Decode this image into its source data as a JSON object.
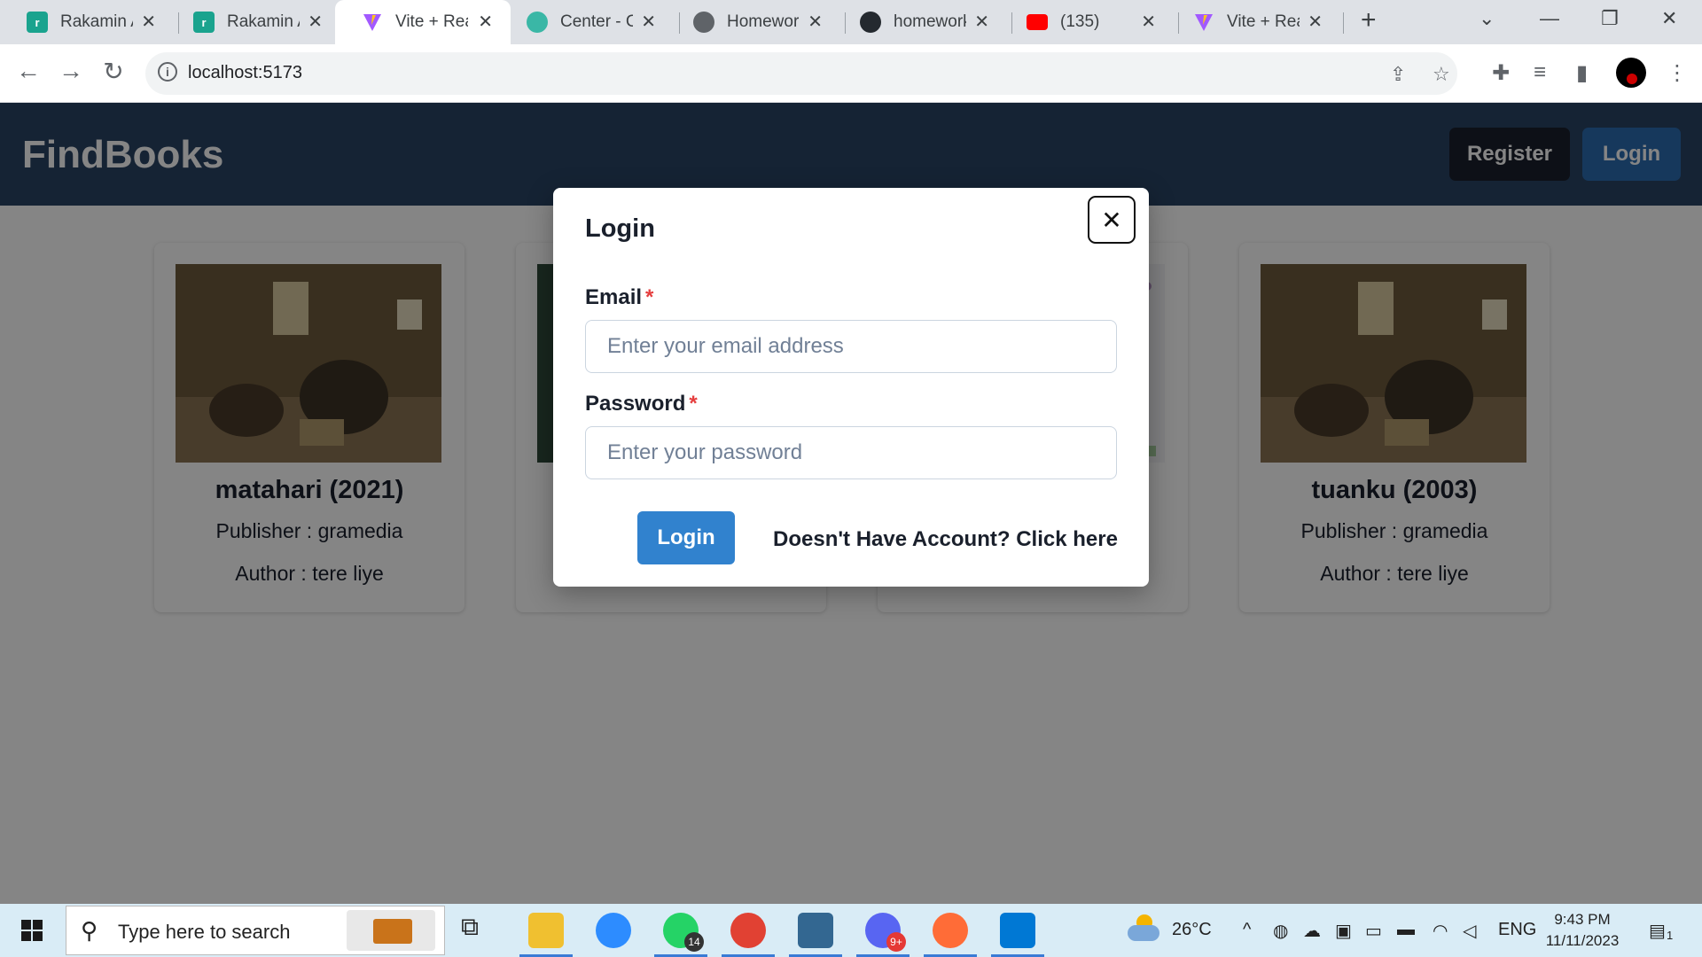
{
  "browser": {
    "tabs": [
      {
        "title": "Rakamin Academy",
        "icon": "rakamin-icon",
        "active": false
      },
      {
        "title": "Rakamin Academy",
        "icon": "rakamin-icon",
        "active": false
      },
      {
        "title": "Vite + React",
        "icon": "vite-icon",
        "active": true
      },
      {
        "title": "Center - Cl",
        "icon": "center-icon",
        "active": false
      },
      {
        "title": "Homework",
        "icon": "globe-icon",
        "active": false
      },
      {
        "title": "homework",
        "icon": "github-icon",
        "active": false
      },
      {
        "title": "(135)",
        "icon": "youtube-icon",
        "active": false
      },
      {
        "title": "Vite + React",
        "icon": "vite-icon",
        "active": false
      }
    ],
    "close_glyph": "✕",
    "new_tab_glyph": "+",
    "url": "localhost:5173"
  },
  "app": {
    "brand": "FindBooks",
    "nav_register": "Register",
    "nav_login": "Login",
    "books": [
      {
        "title": "matahari (2021)",
        "publisher": "Publisher : gramedia",
        "author": "Author : tere liye"
      },
      {
        "title": "",
        "publisher": "",
        "author": ""
      },
      {
        "title": "",
        "publisher": "",
        "author": ""
      },
      {
        "title": "tuanku (2003)",
        "publisher": "Publisher : gramedia",
        "author": "Author : tere liye"
      }
    ]
  },
  "modal": {
    "title": "Login",
    "email_label": "Email",
    "email_placeholder": "Enter your email address",
    "email_value": "",
    "password_label": "Password",
    "password_placeholder": "Enter your password",
    "password_value": "",
    "required_mark": "*",
    "submit_label": "Login",
    "register_link": "Doesn't Have Account? Click here",
    "close_glyph": "✕"
  },
  "taskbar": {
    "search_text": "Type here to search",
    "whatsapp_badge": "14",
    "discord_badge": "9+",
    "temperature": "26°C",
    "language": "ENG",
    "time": "9:43 PM",
    "date": "11/11/2023",
    "notification_count": "1"
  },
  "colors": {
    "navbar": "#2a4365",
    "primary_button": "#3182ce",
    "register_button": "#1a202c",
    "required": "#e53e3e"
  }
}
